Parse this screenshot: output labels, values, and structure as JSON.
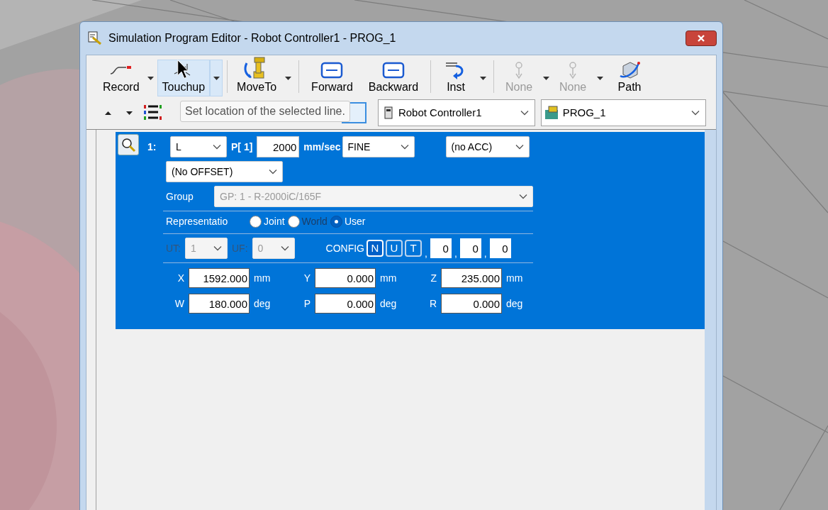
{
  "window": {
    "title": "Simulation Program Editor - Robot Controller1 - PROG_1"
  },
  "toolbar": [
    {
      "label": "Record",
      "kind": "record",
      "dropdown": true,
      "disabled": false,
      "highlighted": false
    },
    {
      "label": "Touchup",
      "kind": "touchup",
      "dropdown": true,
      "disabled": false,
      "highlighted": true
    },
    {
      "label": "MoveTo",
      "kind": "moveto",
      "dropdown": true,
      "disabled": false,
      "highlighted": false
    },
    {
      "label": "Forward",
      "kind": "forward",
      "dropdown": false,
      "disabled": false,
      "highlighted": false
    },
    {
      "label": "Backward",
      "kind": "backward",
      "dropdown": false,
      "disabled": false,
      "highlighted": false
    },
    {
      "label": "Inst",
      "kind": "inst",
      "dropdown": true,
      "disabled": false,
      "highlighted": false
    },
    {
      "label": "None",
      "kind": "none",
      "dropdown": true,
      "disabled": true,
      "highlighted": false
    },
    {
      "label": "None",
      "kind": "none",
      "dropdown": true,
      "disabled": true,
      "highlighted": false
    },
    {
      "label": "Path",
      "kind": "path",
      "dropdown": false,
      "disabled": false,
      "highlighted": false
    }
  ],
  "tooltip": "Set location of the selected line.",
  "controller_select": "Robot Controller1",
  "program_select": "PROG_1",
  "line": {
    "number": "1:",
    "motion": "L",
    "position": "P[ 1]",
    "speed": "2000",
    "speed_unit": "mm/sec",
    "termination": "FINE",
    "acc": "(no ACC)",
    "offset": "(No OFFSET)",
    "group": {
      "label": "Group",
      "value": "GP: 1 - R-2000iC/165F",
      "disabled": true
    },
    "representation": {
      "label": "Representatio",
      "options": [
        {
          "label": "Joint",
          "selected": false,
          "disabled": false
        },
        {
          "label": "World",
          "selected": false,
          "disabled": true
        },
        {
          "label": "User",
          "selected": true,
          "disabled": false
        }
      ]
    },
    "ut": {
      "label": "UT:",
      "value": "1",
      "disabled": true
    },
    "uf": {
      "label": "UF:",
      "value": "0",
      "disabled": true
    },
    "config": {
      "label": "CONFIG",
      "flags": [
        {
          "label": "N",
          "selected": true
        },
        {
          "label": "U",
          "selected": false
        },
        {
          "label": "T",
          "selected": false
        }
      ],
      "turns": [
        {
          "separator": ",",
          "value": "0"
        },
        {
          "separator": ",",
          "value": "0"
        },
        {
          "separator": ",",
          "value": "0"
        }
      ]
    },
    "coords": [
      {
        "axis": "X",
        "value": "1592.000",
        "unit": "mm"
      },
      {
        "axis": "Y",
        "value": "0.000",
        "unit": "mm"
      },
      {
        "axis": "Z",
        "value": "235.000",
        "unit": "mm"
      },
      {
        "axis": "W",
        "value": "180.000",
        "unit": "deg"
      },
      {
        "axis": "P",
        "value": "0.000",
        "unit": "deg"
      },
      {
        "axis": "R",
        "value": "0.000",
        "unit": "deg"
      }
    ]
  }
}
